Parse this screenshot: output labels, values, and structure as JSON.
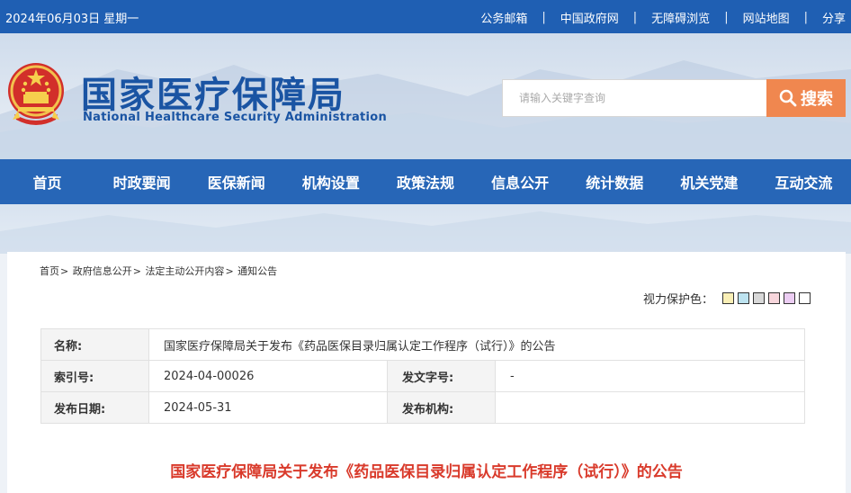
{
  "topbar": {
    "date": "2024年06月03日 星期一",
    "links": [
      "公务邮箱",
      "中国政府网",
      "无障碍浏览",
      "网站地图",
      "分享"
    ],
    "separator": "|"
  },
  "header": {
    "title_cn": "国家医疗保障局",
    "title_en": "National Healthcare Security Administration",
    "search_placeholder": "请输入关键字查询",
    "search_button": "搜索"
  },
  "nav": {
    "items": [
      "首页",
      "时政要闻",
      "医保新闻",
      "机构设置",
      "政策法规",
      "信息公开",
      "统计数据",
      "机关党建",
      "互动交流"
    ]
  },
  "breadcrumb": [
    "首页",
    "政府信息公开",
    "法定主动公开内容",
    "通知公告"
  ],
  "eye_protection": {
    "label": "视力保护色：",
    "swatches": [
      "#f9efb6",
      "#bde3f0",
      "#d8d8d8",
      "#f7d6dc",
      "#eccdf3",
      "#ffffff"
    ]
  },
  "meta": {
    "name_label": "名称:",
    "name_value": "国家医疗保障局关于发布《药品医保目录归属认定工作程序（试行）》的公告",
    "index_label": "索引号:",
    "index_value": "2024-04-00026",
    "docno_label": "发文字号:",
    "docno_value": "-",
    "date_label": "发布日期:",
    "date_value": "2024-05-31",
    "org_label": "发布机构:",
    "org_value": ""
  },
  "doc_title": "国家医疗保障局关于发布《药品医保目录归属认定工作程序（试行）》的公告",
  "colors": {
    "topbar": "#1f5fb3",
    "nav": "#2766b7",
    "brand_text": "#1a54a3",
    "search_button": "#f0874f",
    "doc_title": "#d93a2b"
  }
}
